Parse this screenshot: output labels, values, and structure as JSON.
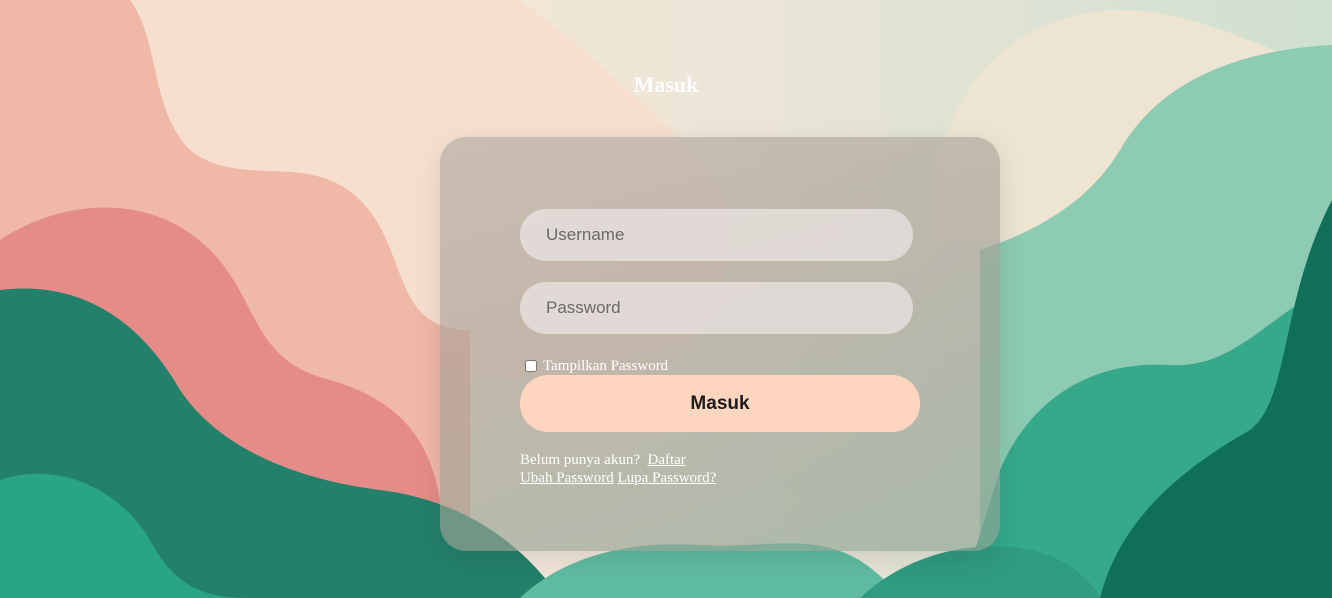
{
  "page": {
    "title": "Masuk"
  },
  "form": {
    "username_placeholder": "Username",
    "password_placeholder": "Password",
    "show_password_label": "Tampilkan Password",
    "submit_label": "Masuk"
  },
  "links": {
    "no_account_text": "Belum punya akun?",
    "register_label": "Daftar",
    "change_password_label": "Ubah Password",
    "forgot_password_label": "Lupa Password?"
  },
  "colors": {
    "submit_button": "#fed5bf",
    "text_light": "#ffffff",
    "card_overlay": "rgba(175,170,160,0.45)"
  }
}
